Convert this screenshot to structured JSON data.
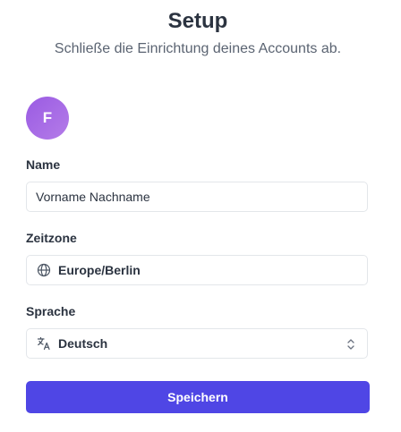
{
  "header": {
    "title": "Setup",
    "subtitle": "Schließe die Einrichtung deines Accounts ab."
  },
  "avatar": {
    "initial": "F",
    "colors": [
      "#9a5be3",
      "#b47ce8"
    ]
  },
  "form": {
    "name": {
      "label": "Name",
      "value": "Vorname Nachname"
    },
    "timezone": {
      "label": "Zeitzone",
      "value": "Europe/Berlin",
      "icon": "globe-icon"
    },
    "language": {
      "label": "Sprache",
      "value": "Deutsch",
      "icon": "translate-icon",
      "chevron": "chevron-up-down-icon"
    }
  },
  "actions": {
    "save_label": "Speichern",
    "accent": "#4f46e5"
  }
}
